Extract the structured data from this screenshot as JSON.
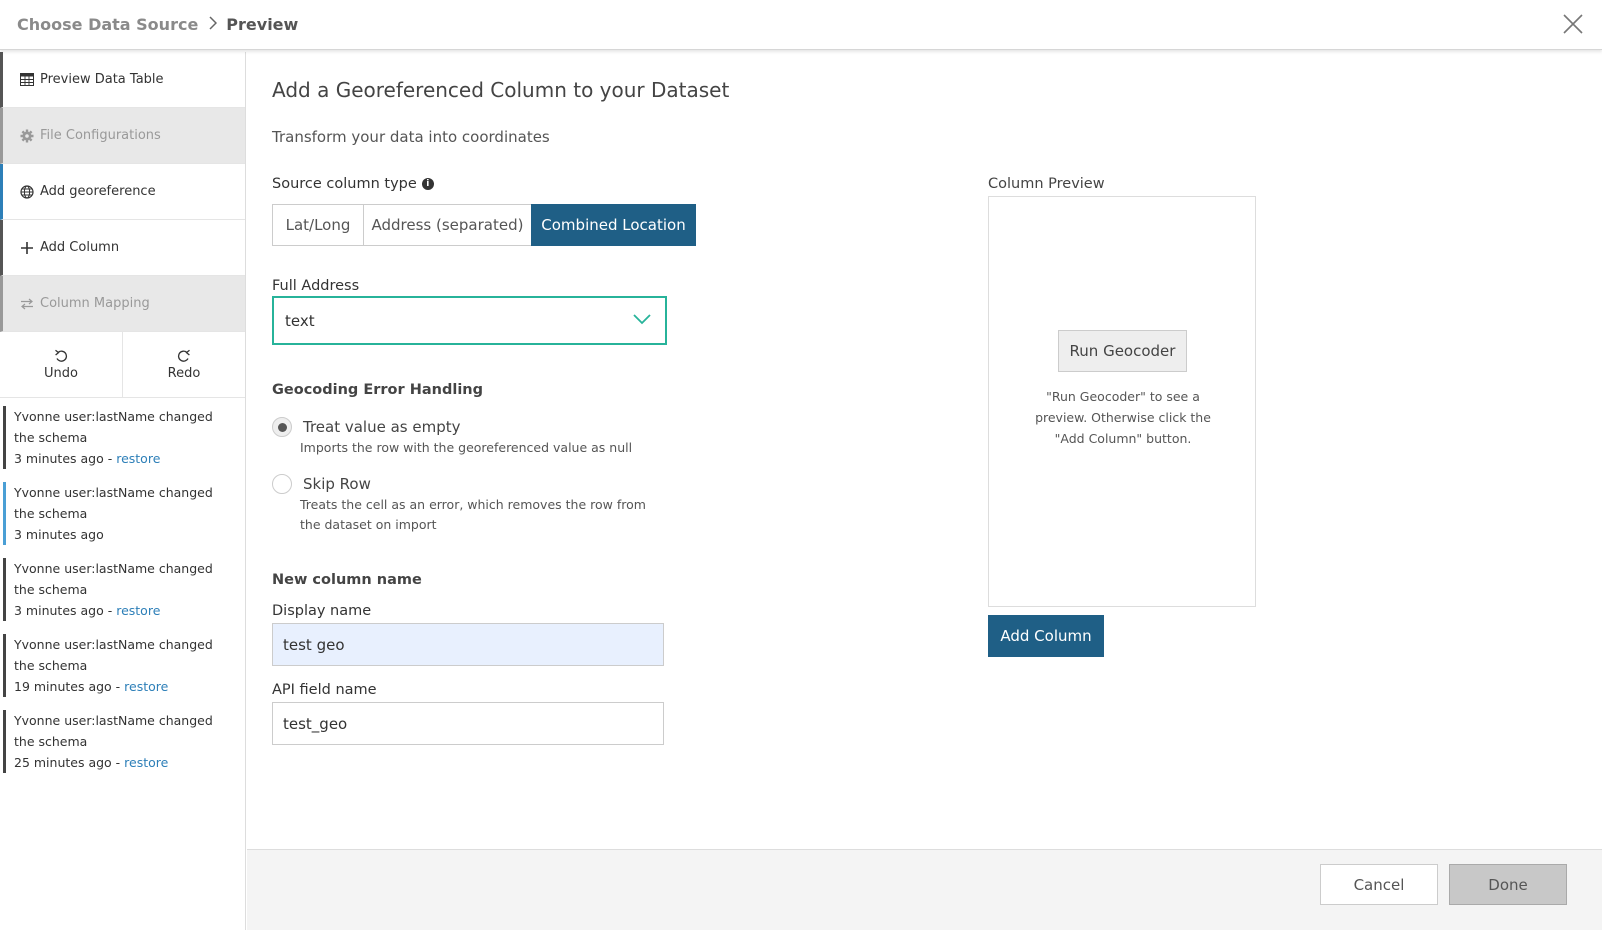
{
  "header": {
    "breadcrumb_prev": "Choose Data Source",
    "breadcrumb_current": "Preview",
    "close_icon": "close-icon"
  },
  "sidebar": {
    "items": [
      {
        "label": "Preview Data Table",
        "icon": "table-icon",
        "state": "normal"
      },
      {
        "label": "File Configurations",
        "icon": "gear-icon",
        "state": "disabled"
      },
      {
        "label": "Add georeference",
        "icon": "globe-icon",
        "state": "active"
      },
      {
        "label": "Add Column",
        "icon": "plus-icon",
        "state": "normal"
      },
      {
        "label": "Column Mapping",
        "icon": "swap-icon",
        "state": "disabled"
      }
    ],
    "undo_label": "Undo",
    "redo_label": "Redo",
    "history": [
      {
        "text": "Yvonne user:lastName changed the schema",
        "time": "3 minutes ago",
        "restore": "restore"
      },
      {
        "text": "Yvonne user:lastName changed the schema",
        "time": "3 minutes ago",
        "restore": ""
      },
      {
        "text": "Yvonne user:lastName changed the schema",
        "time": "3 minutes ago",
        "restore": "restore"
      },
      {
        "text": "Yvonne user:lastName changed the schema",
        "time": "19 minutes ago",
        "restore": "restore"
      },
      {
        "text": "Yvonne user:lastName changed the schema",
        "time": "25 minutes ago",
        "restore": "restore"
      }
    ],
    "restore_separator": " - "
  },
  "main": {
    "title": "Add a Georeferenced Column to your Dataset",
    "subtitle": "Transform your data into coordinates",
    "source_type_label": "Source column type",
    "source_types": [
      "Lat/Long",
      "Address (separated)",
      "Combined Location"
    ],
    "selected_source_type": "Combined Location",
    "full_address_label": "Full Address",
    "full_address_value": "text",
    "error_handling_label": "Geocoding Error Handling",
    "options": [
      {
        "label": "Treat value as empty",
        "desc": "Imports the row with the georeferenced value as null",
        "checked": true
      },
      {
        "label": "Skip Row",
        "desc": "Treats the cell as an error, which removes the row from the dataset on import",
        "checked": false
      }
    ],
    "new_column_label": "New column name",
    "display_name_label": "Display name",
    "display_name_value": "test geo",
    "api_field_label": "API field name",
    "api_field_value": "test_geo"
  },
  "preview": {
    "label": "Column Preview",
    "run_button": "Run Geocoder",
    "note": "\"Run Geocoder\" to see a preview. Otherwise click the \"Add Column\" button.",
    "add_column_button": "Add Column"
  },
  "footer": {
    "cancel": "Cancel",
    "done": "Done"
  },
  "colors": {
    "primary": "#1f5f86",
    "accent_teal": "#27b39a",
    "link": "#2d7fb8"
  }
}
